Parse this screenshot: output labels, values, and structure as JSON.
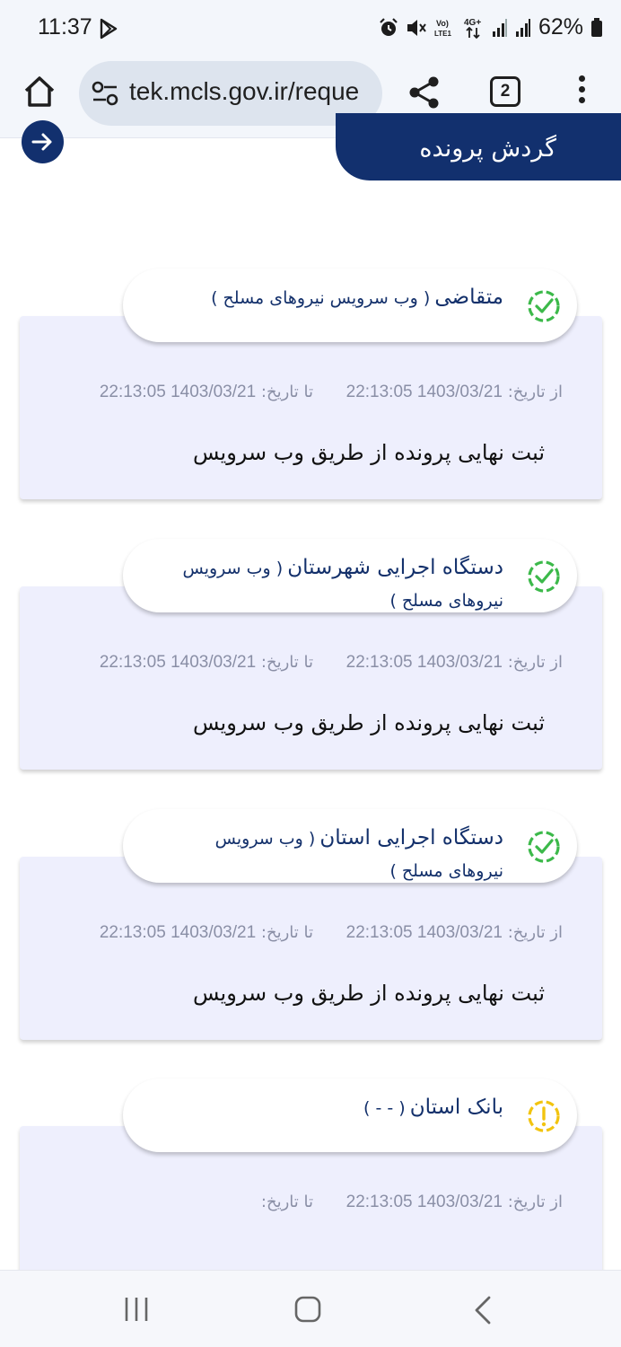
{
  "status_bar": {
    "time": "11:37",
    "battery": "62%",
    "icons": [
      "play-store-icon",
      "alarm-icon",
      "mute-icon",
      "volte-icon",
      "4g-icon",
      "signal-icon",
      "signal-icon",
      "battery-icon"
    ]
  },
  "browser": {
    "url": "tek.mcls.gov.ir/reque",
    "tab_count": "2"
  },
  "header": {
    "title": "گردش پرونده"
  },
  "labels": {
    "from_date": "از تاریخ:",
    "to_date": "تا تاریخ:"
  },
  "cards": [
    {
      "title": "متقاضی",
      "subtitle": "( وب سرویس نیروهای مسلح )",
      "subtitle_wrap": "",
      "status": "done",
      "from_date": "1403/03/21 22:13:05",
      "to_date": "1403/03/21 22:13:05",
      "description": "ثبت نهایی پرونده از طریق وب سرویس"
    },
    {
      "title": "دستگاه اجرایی شهرستان",
      "subtitle": "( وب سرویس",
      "subtitle_wrap": "نیروهای مسلح )",
      "status": "done",
      "from_date": "1403/03/21 22:13:05",
      "to_date": "1403/03/21 22:13:05",
      "description": "ثبت نهایی پرونده از طریق وب سرویس"
    },
    {
      "title": "دستگاه اجرایی استان",
      "subtitle": "( وب سرویس",
      "subtitle_wrap": "نیروهای مسلح )",
      "status": "done",
      "from_date": "1403/03/21 22:13:05",
      "to_date": "1403/03/21 22:13:05",
      "description": "ثبت نهایی پرونده از طریق وب سرویس"
    },
    {
      "title": "بانک استان",
      "subtitle": "( - - )",
      "subtitle_wrap": "",
      "status": "pending",
      "from_date": "1403/03/21 22:13:05",
      "to_date": "",
      "description": ""
    }
  ],
  "colors": {
    "primary": "#12306e",
    "done": "#3cb94a",
    "pending": "#f2c40f",
    "card_bg": "#eeeffd"
  }
}
